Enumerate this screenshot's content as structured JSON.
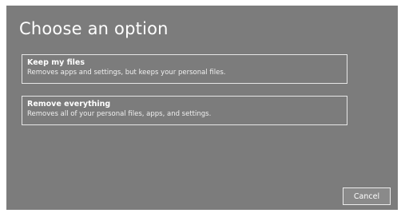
{
  "dialog": {
    "title": "Choose an option",
    "options": [
      {
        "title": "Keep my files",
        "description": "Removes apps and settings, but keeps your personal files."
      },
      {
        "title": "Remove everything",
        "description": "Removes all of your personal files, apps, and settings."
      }
    ],
    "cancel_label": "Cancel"
  },
  "colors": {
    "dialog_background": "#7c7c7c",
    "text": "#ffffff",
    "option_border": "#e6e6e6"
  }
}
